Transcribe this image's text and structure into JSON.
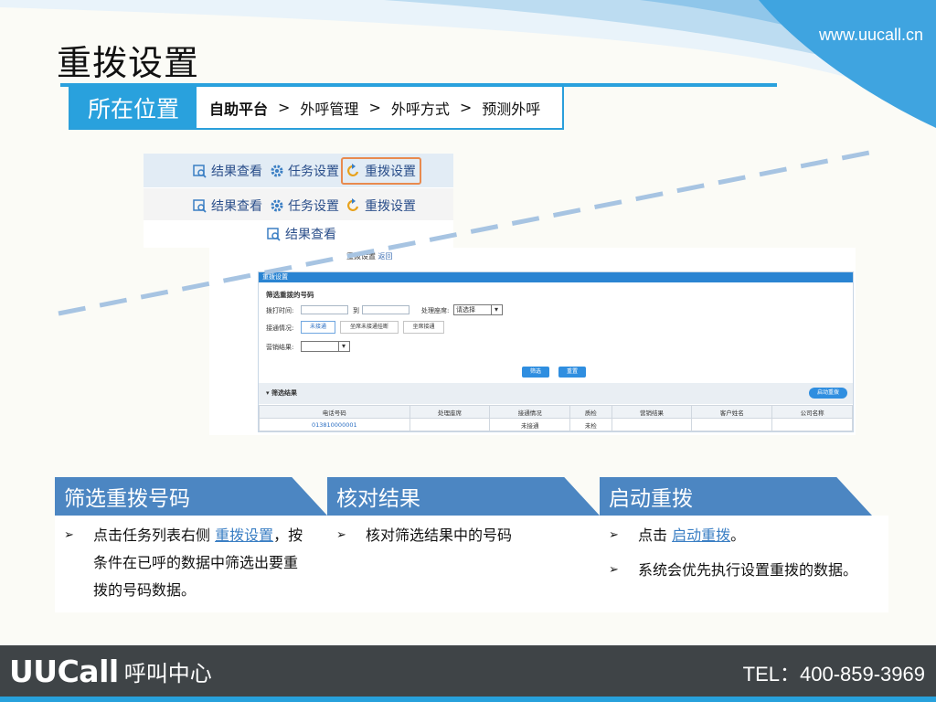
{
  "header": {
    "title": "重拨设置",
    "site_url": "www.uucall.cn"
  },
  "location": {
    "label": "所在位置",
    "crumbs": [
      "自助平台",
      "外呼管理",
      "外呼方式",
      "预测外呼"
    ],
    "separator": ">"
  },
  "actions": {
    "row1": [
      "结果查看",
      "任务设置",
      "重拨设置"
    ],
    "row2": [
      "结果查看",
      "任务设置",
      "重拨设置"
    ],
    "row3": [
      "结果查看"
    ]
  },
  "app": {
    "top_link": "重拨设置",
    "top_back": "返回",
    "panel_title": "重拨设置",
    "form_title": "筛选重拨的号码",
    "call_time_label": "拨打时间:",
    "to_label": "到",
    "seat_label": "处理座席:",
    "seat_placeholder": "请选择",
    "connect_label": "接通情况:",
    "connect_tabs": [
      "未接通",
      "坐席未接通挂断",
      "坐席接通"
    ],
    "marketing_label": "营销结果:",
    "filter_btn": "筛选",
    "reset_btn": "重置",
    "result_title": "▾ 筛选结果",
    "start_btn": "启动重拨",
    "table_headers": [
      "电话号码",
      "处理座席",
      "接通情况",
      "质检",
      "营销结果",
      "客户姓名",
      "公司名称"
    ],
    "table_rows": [
      [
        "013810000001",
        "",
        "未接通",
        "未检",
        "",
        "",
        ""
      ]
    ]
  },
  "cards": {
    "c1_title": "筛选重拨号码",
    "c1_pre": "点击任务列表右侧 ",
    "c1_link": "重拨设置",
    "c1_post": "，按条件在已呼的数据中筛选出要重拨的号码数据。",
    "c2_title": "核对结果",
    "c2_text": "核对筛选结果中的号码",
    "c3_title": "启动重拨",
    "c3_pre": "点击 ",
    "c3_link": "启动重拨",
    "c3_post": "。",
    "c3_text2": "系统会优先执行设置重拨的数据。",
    "bullet": "➢"
  },
  "footer": {
    "brand": "UUCall",
    "brand_sub": "呼叫中心",
    "tel": "TEL：400-859-3969"
  },
  "colors": {
    "accent": "#29a1dd",
    "card": "#4c86c2",
    "highlight": "#e88a4f",
    "footer": "#3f4447"
  }
}
